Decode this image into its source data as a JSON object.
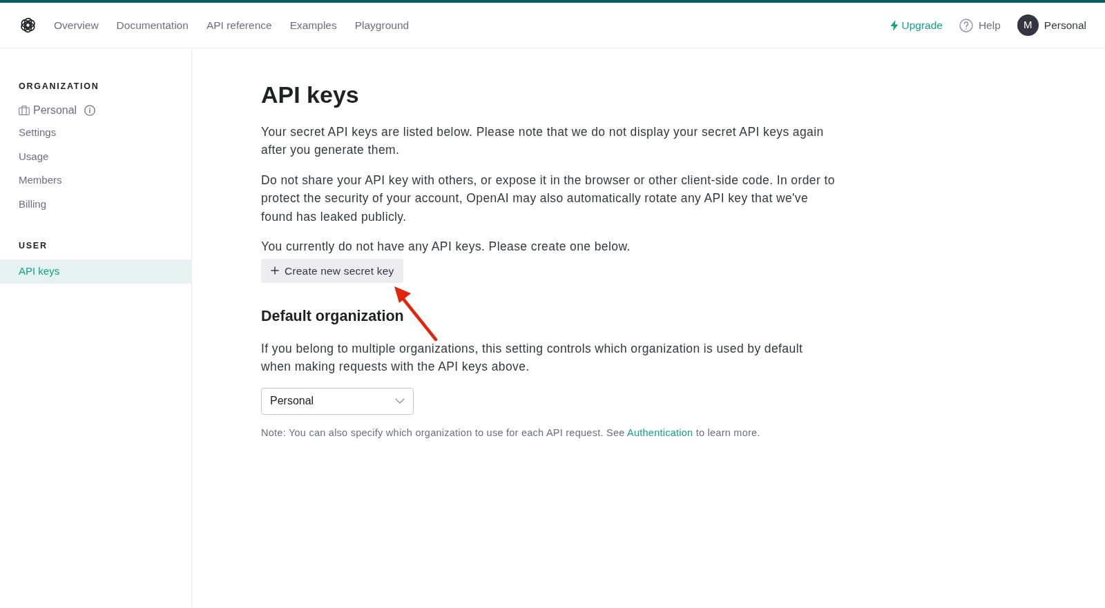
{
  "top_nav": {
    "links": [
      {
        "label": "Overview",
        "selected": false
      },
      {
        "label": "Documentation",
        "selected": false
      },
      {
        "label": "API reference",
        "selected": false
      },
      {
        "label": "Examples",
        "selected": false
      },
      {
        "label": "Playground",
        "selected": false
      }
    ],
    "upgrade": "Upgrade",
    "help": "Help",
    "account": {
      "initial": "M",
      "name": "Personal"
    }
  },
  "sidebar": {
    "sections": [
      {
        "heading": "ORGANIZATION",
        "items": [
          {
            "kind": "organization",
            "label": "Personal",
            "selected": false
          },
          {
            "kind": "link",
            "label": "Settings",
            "selected": false
          },
          {
            "kind": "link",
            "label": "Usage",
            "selected": false
          },
          {
            "kind": "link",
            "label": "Members",
            "selected": false
          },
          {
            "kind": "link",
            "label": "Billing",
            "selected": false
          }
        ]
      },
      {
        "heading": "USER",
        "items": [
          {
            "kind": "link",
            "label": "API keys",
            "selected": true
          }
        ]
      }
    ]
  },
  "main": {
    "title": "API keys",
    "paragraphs": [
      "Your secret API keys are listed below. Please note that we do not display your secret API keys again after you generate them.",
      "Do not share your API key with others, or expose it in the browser or other client-side code. In order to protect the security of your account, OpenAI may also automatically rotate any API key that we've found has leaked publicly.",
      "You currently do not have any API keys. Please create one below."
    ],
    "create_button": "Create new secret key",
    "default_organization": {
      "heading": "Default organization",
      "description": "If you belong to multiple organizations, this setting controls which organization is used by default when making requests with the API keys above.",
      "select": {
        "value": "Personal"
      },
      "note": {
        "before": "Note: You can also specify which organization to use for each API request. See",
        "link": "Authentication",
        "after": "to learn more."
      }
    }
  }
}
